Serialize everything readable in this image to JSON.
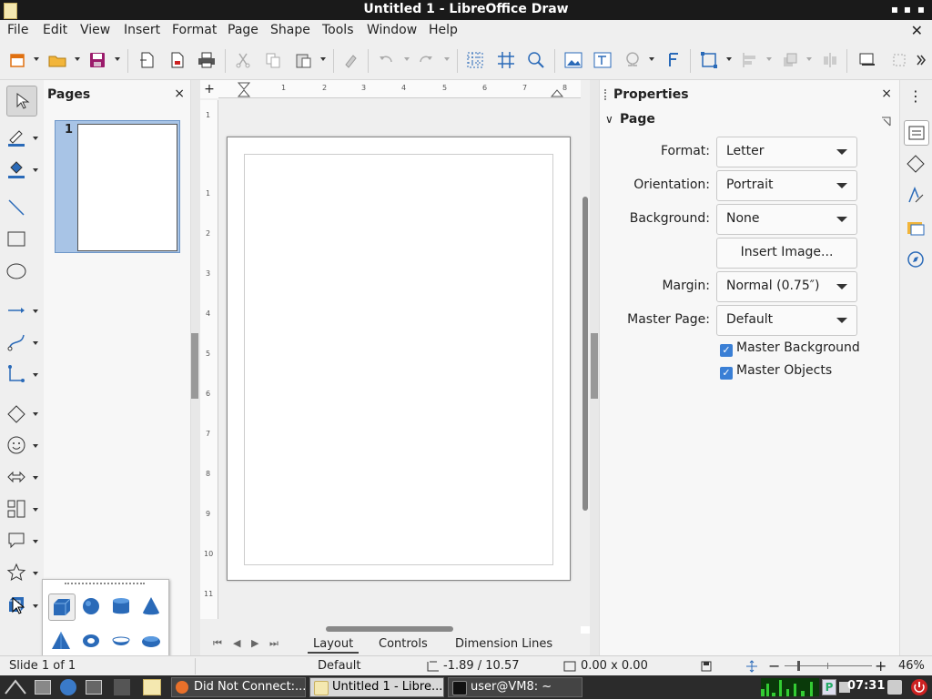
{
  "window": {
    "title": "Untitled 1 - LibreOffice Draw"
  },
  "menu": [
    "File",
    "Edit",
    "View",
    "Insert",
    "Format",
    "Page",
    "Shape",
    "Tools",
    "Window",
    "Help"
  ],
  "pages_panel": {
    "title": "Pages",
    "close": "×",
    "page_number": "1"
  },
  "properties": {
    "title": "Properties",
    "close": "×",
    "section": "Page",
    "format": {
      "label": "Format:",
      "value": "Letter"
    },
    "orientation": {
      "label": "Orientation:",
      "value": "Portrait"
    },
    "background": {
      "label": "Background:",
      "value": "None"
    },
    "insert_image": "Insert Image...",
    "margin": {
      "label": "Margin:",
      "value": "Normal (0.75″)"
    },
    "master_page": {
      "label": "Master Page:",
      "value": "Default"
    },
    "master_background": {
      "label": "Master Background",
      "checked": true
    },
    "master_objects": {
      "label": "Master Objects",
      "checked": true
    }
  },
  "ruler": {
    "h": [
      "1",
      "2",
      "3",
      "4",
      "5",
      "6",
      "7",
      "8"
    ],
    "v": [
      "1",
      "1",
      "2",
      "3",
      "4",
      "5",
      "6",
      "7",
      "8",
      "9",
      "10",
      "11"
    ]
  },
  "tabs": [
    "Layout",
    "Controls",
    "Dimension Lines"
  ],
  "status": {
    "slide": "Slide 1 of 1",
    "master": "Default",
    "position": "-1.89 / 10.57",
    "size": "0.00 x 0.00",
    "zoom": "46%"
  },
  "taskbar": {
    "tasks": [
      "Did Not Connect:...",
      "Untitled 1 - Libre...",
      "user@VM8: ~"
    ],
    "clock": "07:31"
  },
  "colors": {
    "accent": "#3a7fd5",
    "thumb_selected": "#a8c4e6"
  }
}
